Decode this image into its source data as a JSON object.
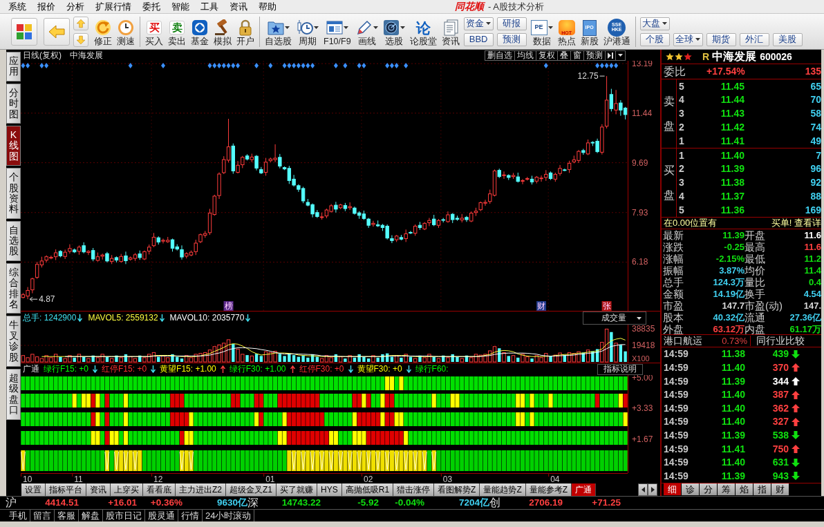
{
  "menu_bar": {
    "items": [
      "系统",
      "报价",
      "分析",
      "扩展行情",
      "委托",
      "智能",
      "工具",
      "资讯",
      "帮助"
    ],
    "brand": "同花顺",
    "title": "- A股技术分析"
  },
  "toolbar": {
    "tools": [
      {
        "label": "修正",
        "dropdown": false
      },
      {
        "label": "测速",
        "dropdown": false
      },
      {
        "label": "买入",
        "dropdown": false,
        "glyph": "买"
      },
      {
        "label": "卖出",
        "dropdown": false,
        "glyph": "卖"
      },
      {
        "label": "基金",
        "dropdown": false
      },
      {
        "label": "模拟",
        "dropdown": false
      },
      {
        "label": "开户",
        "dropdown": false
      },
      {
        "label": "自选股",
        "dropdown": true
      },
      {
        "label": "周期",
        "dropdown": true
      },
      {
        "label": "F10/F9",
        "dropdown": true
      },
      {
        "label": "画线",
        "dropdown": true
      },
      {
        "label": "选股",
        "dropdown": true
      },
      {
        "label": "论股堂",
        "dropdown": false,
        "glyph": "论"
      },
      {
        "label": "资讯",
        "dropdown": false
      }
    ],
    "stacked": [
      {
        "top": {
          "label": "资金",
          "dropdown": true
        },
        "bottom": {
          "label": "BBD",
          "dropdown": false
        }
      },
      {
        "top": {
          "label": "研报",
          "dropdown": false
        },
        "bottom": {
          "label": "预测",
          "dropdown": false
        }
      }
    ],
    "extras": [
      {
        "label": "数据",
        "dropdown": true,
        "glyph": "PE"
      },
      {
        "label": "热点",
        "dropdown": false,
        "glyph": "HOT"
      },
      {
        "label": "新股",
        "dropdown": false,
        "glyph": "IPO"
      },
      {
        "label": "沪港通",
        "dropdown": false,
        "glyph": "SSE HKE"
      }
    ],
    "markets": [
      {
        "top": {
          "label": "大盘",
          "dropdown": true
        },
        "bottom": {
          "label": "个股",
          "dropdown": false
        }
      },
      {
        "bottom": {
          "label": "全球",
          "dropdown": true
        }
      },
      {
        "bottom": {
          "label": "期货",
          "dropdown": false
        }
      },
      {
        "bottom": {
          "label": "外汇",
          "dropdown": false
        }
      },
      {
        "bottom": {
          "label": "美股",
          "dropdown": false
        }
      }
    ]
  },
  "side_tabs": [
    {
      "label": "应用",
      "selected": false
    },
    {
      "label": "分时图",
      "selected": false
    },
    {
      "label": "K线图",
      "selected": true
    },
    {
      "label": "个股资料",
      "selected": false
    },
    {
      "label": "自选股",
      "selected": false
    },
    {
      "label": "综合排名",
      "selected": false
    },
    {
      "label": "牛叉诊股",
      "selected": false
    },
    {
      "label": "超级盘口",
      "selected": false
    }
  ],
  "chart": {
    "period": "日线(复权)",
    "stock": "中海发展",
    "tools": [
      "删自选",
      "均线",
      "复权",
      "叠",
      "窗",
      "预测"
    ],
    "events": [
      {
        "label": "榜",
        "color": "#5a2a8a"
      },
      {
        "label": "财",
        "color": "#203a8a"
      },
      {
        "label": "张",
        "color": "#b01818"
      }
    ],
    "chart_data": {
      "type": "candlestick",
      "ohlc": [
        [
          4.93,
          5.09,
          4.9,
          5.03
        ],
        [
          4.98,
          5.3,
          4.87,
          5.18
        ],
        [
          5.2,
          5.63,
          5.08,
          5.59
        ],
        [
          5.64,
          6.19,
          5.59,
          6.1
        ],
        [
          6.08,
          6.37,
          5.99,
          6.22
        ],
        [
          6.25,
          6.42,
          6.17,
          6.37
        ],
        [
          6.32,
          6.41,
          6.28,
          6.35
        ],
        [
          6.37,
          6.63,
          6.25,
          6.51
        ],
        [
          6.56,
          6.6,
          6.35,
          6.4
        ],
        [
          6.38,
          6.62,
          6.29,
          6.53
        ],
        [
          6.56,
          6.81,
          6.48,
          6.66
        ],
        [
          6.61,
          6.66,
          6.5,
          6.54
        ],
        [
          6.56,
          6.77,
          6.44,
          6.71
        ],
        [
          6.76,
          6.88,
          6.49,
          6.54
        ],
        [
          6.52,
          6.6,
          6.43,
          6.56
        ],
        [
          6.59,
          6.68,
          6.21,
          6.29
        ],
        [
          6.24,
          6.52,
          6.2,
          6.37
        ],
        [
          6.39,
          6.48,
          6.27,
          6.43
        ],
        [
          6.48,
          6.54,
          6.17,
          6.22
        ],
        [
          6.2,
          6.43,
          6.11,
          6.31
        ],
        [
          6.34,
          6.38,
          6.17,
          6.25
        ],
        [
          6.2,
          6.47,
          6.16,
          6.38
        ],
        [
          6.4,
          6.55,
          6.11,
          6.23
        ],
        [
          6.28,
          6.38,
          6.23,
          6.33
        ],
        [
          6.31,
          6.5,
          6.22,
          6.44
        ],
        [
          6.47,
          6.59,
          6.26,
          6.34
        ],
        [
          6.29,
          6.59,
          6.25,
          6.55
        ],
        [
          6.57,
          6.8,
          6.45,
          6.71
        ],
        [
          6.76,
          7.21,
          6.71,
          7.06
        ],
        [
          7.04,
          7.09,
          6.8,
          6.89
        ],
        [
          6.92,
          7.01,
          6.84,
          6.95
        ],
        [
          6.9,
          7.07,
          6.86,
          6.95
        ],
        [
          6.97,
          7.01,
          6.55,
          6.67
        ],
        [
          6.72,
          6.81,
          6.59,
          6.64
        ],
        [
          6.62,
          6.77,
          6.27,
          6.36
        ],
        [
          6.39,
          6.53,
          6.31,
          6.48
        ],
        [
          6.43,
          6.59,
          6.39,
          6.53
        ],
        [
          6.55,
          6.97,
          6.43,
          6.85
        ],
        [
          6.9,
          7.19,
          6.85,
          7.15
        ],
        [
          7.13,
          7.28,
          7.04,
          7.19
        ],
        [
          7.22,
          8.06,
          7.14,
          7.91
        ],
        [
          7.86,
          8.56,
          7.82,
          8.51
        ],
        [
          8.53,
          9.35,
          8.41,
          9.29
        ],
        [
          9.34,
          9.92,
          9.29,
          9.8
        ],
        [
          9.78,
          11.24,
          9.7,
          10.25
        ],
        [
          10.28,
          10.37,
          9.3,
          9.4
        ],
        [
          9.35,
          9.75,
          9.31,
          9.6
        ],
        [
          9.62,
          9.93,
          9.5,
          9.88
        ],
        [
          9.93,
          9.99,
          9.77,
          9.82
        ],
        [
          9.8,
          10.01,
          9.71,
          9.89
        ],
        [
          9.92,
          9.96,
          9.42,
          9.5
        ],
        [
          9.45,
          9.54,
          9.29,
          9.33
        ],
        [
          9.35,
          9.86,
          9.23,
          9.71
        ],
        [
          9.76,
          9.87,
          9.71,
          9.82
        ],
        [
          9.8,
          10.34,
          9.71,
          9.85
        ],
        [
          9.88,
          10.0,
          9.49,
          9.57
        ],
        [
          9.52,
          9.56,
          9.43,
          9.47
        ],
        [
          9.49,
          9.58,
          8.94,
          9.06
        ],
        [
          9.11,
          9.26,
          8.85,
          8.9
        ],
        [
          8.88,
          8.93,
          8.66,
          8.75
        ],
        [
          8.78,
          8.84,
          8.26,
          8.34
        ],
        [
          8.29,
          8.41,
          8.15,
          8.19
        ],
        [
          8.21,
          8.25,
          7.76,
          7.88
        ],
        [
          7.93,
          8.02,
          7.74,
          7.79
        ],
        [
          7.77,
          7.93,
          7.68,
          7.78
        ],
        [
          7.81,
          8.07,
          7.73,
          8.02
        ],
        [
          7.97,
          8.23,
          7.93,
          8.17
        ],
        [
          8.19,
          8.31,
          7.93,
          8.05
        ],
        [
          8.1,
          8.24,
          8.05,
          8.2
        ],
        [
          8.18,
          8.27,
          7.98,
          8.07
        ],
        [
          8.1,
          8.29,
          8.02,
          8.14
        ],
        [
          8.09,
          8.14,
          7.86,
          7.9
        ],
        [
          7.92,
          7.98,
          7.71,
          7.83
        ],
        [
          7.88,
          8.0,
          7.67,
          7.72
        ],
        [
          7.7,
          7.74,
          7.39,
          7.48
        ],
        [
          7.51,
          7.64,
          7.43,
          7.55
        ],
        [
          7.5,
          7.65,
          7.42,
          7.46
        ],
        [
          7.48,
          7.53,
          7.28,
          7.4
        ],
        [
          7.45,
          7.51,
          6.98,
          7.03
        ],
        [
          7.01,
          7.13,
          6.85,
          6.94
        ],
        [
          6.97,
          7.14,
          6.89,
          7.1
        ],
        [
          7.05,
          7.14,
          6.95,
          6.99
        ],
        [
          7.01,
          7.33,
          6.89,
          7.18
        ],
        [
          7.23,
          7.28,
          7.17,
          7.22
        ],
        [
          7.2,
          7.51,
          7.11,
          7.45
        ],
        [
          7.48,
          7.6,
          7.32,
          7.4
        ],
        [
          7.35,
          7.59,
          7.31,
          7.55
        ],
        [
          7.57,
          7.74,
          7.45,
          7.65
        ],
        [
          7.7,
          7.85,
          7.45,
          7.5
        ],
        [
          7.48,
          7.7,
          7.39,
          7.65
        ],
        [
          7.68,
          7.74,
          7.58,
          7.66
        ],
        [
          7.61,
          7.97,
          7.57,
          7.85
        ],
        [
          7.87,
          7.91,
          7.56,
          7.68
        ],
        [
          7.73,
          7.82,
          7.64,
          7.69
        ],
        [
          7.67,
          7.88,
          7.58,
          7.73
        ],
        [
          7.76,
          7.81,
          7.6,
          7.68
        ],
        [
          7.63,
          7.97,
          7.59,
          7.91
        ],
        [
          7.93,
          8.1,
          7.81,
          7.98
        ],
        [
          8.03,
          8.32,
          7.98,
          8.28
        ],
        [
          8.26,
          8.38,
          8.17,
          8.29
        ],
        [
          8.32,
          8.74,
          8.24,
          8.59
        ],
        [
          8.54,
          9.45,
          8.5,
          9.4
        ],
        [
          9.42,
          9.48,
          9.15,
          9.2
        ],
        [
          9.25,
          9.38,
          9.12,
          9.26
        ],
        [
          9.24,
          9.28,
          9.08,
          9.17
        ],
        [
          9.2,
          9.33,
          9.12,
          9.24
        ],
        [
          9.19,
          9.34,
          8.99,
          9.03
        ],
        [
          9.05,
          9.11,
          8.93,
          9.06
        ],
        [
          9.11,
          9.19,
          9.06,
          9.13
        ],
        [
          9.11,
          9.23,
          8.92,
          9.01
        ],
        [
          9.04,
          9.22,
          8.96,
          9.18
        ],
        [
          9.13,
          9.24,
          9.02,
          9.15
        ],
        [
          9.17,
          9.43,
          9.05,
          9.28
        ],
        [
          9.33,
          9.38,
          9.08,
          9.13
        ],
        [
          9.11,
          9.34,
          9.02,
          9.28
        ],
        [
          9.31,
          9.61,
          9.23,
          9.49
        ],
        [
          9.44,
          9.48,
          9.39,
          9.43
        ],
        [
          9.45,
          9.76,
          9.33,
          9.67
        ],
        [
          9.72,
          9.94,
          9.67,
          9.79
        ],
        [
          9.77,
          10.14,
          9.68,
          10.09
        ],
        [
          10.12,
          10.18,
          9.97,
          10.05
        ],
        [
          10.0,
          10.51,
          9.96,
          10.39
        ],
        [
          10.41,
          10.45,
          10.28,
          10.4
        ],
        [
          10.45,
          10.54,
          10.03,
          10.08
        ],
        [
          10.06,
          11.05,
          9.98,
          10.95
        ],
        [
          10.98,
          12.75,
          10.9,
          11.9
        ],
        [
          12.1,
          12.3,
          11.5,
          11.6
        ],
        [
          11.55,
          12.26,
          11.4,
          11.78
        ],
        [
          11.8,
          11.9,
          11.35,
          11.55
        ],
        [
          11.62,
          11.66,
          11.22,
          11.39
        ]
      ],
      "ylim": [
        4.46,
        13.29
      ],
      "yticks": [
        13.19,
        11.44,
        9.69,
        7.93,
        6.18
      ],
      "grid": true,
      "annotations": [
        "12.75",
        "4.87"
      ]
    }
  },
  "volume": {
    "readings": [
      {
        "label": "总手: 1242900",
        "color": "#40e0f0",
        "rising": false
      },
      {
        "label": "MAVOL5: 2559132",
        "color": "#ffff40",
        "rising": false
      },
      {
        "label": "MAVOL10: 2035770",
        "color": "#ffffff",
        "rising": false
      }
    ],
    "selector": "成交量",
    "axis": [
      "38835",
      "19418",
      "X100"
    ]
  },
  "indicator": {
    "name": "广通",
    "readings": [
      {
        "label": "绿行F15: +0",
        "color": "#00ff00",
        "rising": false
      },
      {
        "label": "红停F15: +0",
        "color": "#ff3030",
        "rising": false
      },
      {
        "label": "黄望F15: +1.00",
        "color": "#ffff00",
        "rising": true
      },
      {
        "label": "绿行F30: +1.00",
        "color": "#00ff00",
        "rising": true
      },
      {
        "label": "红停F30: +0",
        "color": "#ff3030",
        "rising": false
      },
      {
        "label": "黄望F30: +0",
        "color": "#ffff00",
        "rising": false
      },
      {
        "label": "绿行F60:",
        "color": "#00ff00"
      }
    ],
    "help": "指标说明",
    "axis": [
      "+5.00",
      "+3.33",
      "+1.67"
    ],
    "dates": [
      "10",
      "11",
      "12",
      "01",
      "02",
      "03",
      "04"
    ]
  },
  "formula_tabs": [
    {
      "label": "设置",
      "selected": false
    },
    {
      "label": "指标平台",
      "selected": false
    },
    {
      "label": "资讯",
      "selected": false
    },
    {
      "label": "上穿买",
      "selected": false
    },
    {
      "label": "看看底",
      "selected": false
    },
    {
      "label": "主力进出Z2",
      "selected": false
    },
    {
      "label": "超级金叉Z1",
      "selected": false
    },
    {
      "label": "买了就赚",
      "selected": false
    },
    {
      "label": "HYS",
      "selected": false
    },
    {
      "label": "高抛低吸R1",
      "selected": false
    },
    {
      "label": "猎击涨停",
      "selected": false
    },
    {
      "label": "看图解势Z",
      "selected": false
    },
    {
      "label": "量能趋势Z",
      "selected": false
    },
    {
      "label": "量能参考Z",
      "selected": false
    },
    {
      "label": "广通",
      "selected": true
    }
  ],
  "quote": {
    "rating": [
      {
        "color": "#f4c430"
      },
      {
        "color": "#f4c430"
      },
      {
        "color": "#e02020"
      }
    ],
    "badge": "R",
    "name": "中海发展",
    "code": "600026",
    "ratio": {
      "label": "委比",
      "value": "+17.54%",
      "difference": "135"
    },
    "asks": {
      "label": "卖盘",
      "levels": [
        {
          "level": "5",
          "price": "11.45",
          "volume": "65"
        },
        {
          "level": "4",
          "price": "11.44",
          "volume": "70"
        },
        {
          "level": "3",
          "price": "11.43",
          "volume": "58"
        },
        {
          "level": "2",
          "price": "11.42",
          "volume": "74"
        },
        {
          "level": "1",
          "price": "11.41",
          "volume": "49"
        }
      ]
    },
    "bids": {
      "label": "买盘",
      "levels": [
        {
          "level": "1",
          "price": "11.40",
          "volume": "7"
        },
        {
          "level": "2",
          "price": "11.39",
          "volume": "96"
        },
        {
          "level": "3",
          "price": "11.38",
          "volume": "92"
        },
        {
          "level": "4",
          "price": "11.37",
          "volume": "88"
        },
        {
          "level": "5",
          "price": "11.36",
          "volume": "169"
        }
      ]
    },
    "notice": {
      "left": "在0.00位置有",
      "right": "买单! 查看详"
    },
    "stats": [
      {
        "label": "最新",
        "value": "11.39",
        "color": "#10e010"
      },
      {
        "label": "开盘",
        "value": "11.6",
        "color": "#ffffff"
      },
      {
        "label": "涨跌",
        "value": "-0.25",
        "color": "#10e010"
      },
      {
        "label": "最高",
        "value": "11.6",
        "color": "#ff4040"
      },
      {
        "label": "涨幅",
        "value": "-2.15%",
        "color": "#10e010"
      },
      {
        "label": "最低",
        "value": "11.2",
        "color": "#10e010"
      },
      {
        "label": "振幅",
        "value": "3.87%",
        "color": "#40d0f0"
      },
      {
        "label": "均价",
        "value": "11.4",
        "color": "#10e010"
      },
      {
        "label": "总手",
        "value": "124.3万",
        "color": "#40d0f0"
      },
      {
        "label": "量比",
        "value": "0.4",
        "color": "#10e010"
      },
      {
        "label": "金额",
        "value": "14.19亿",
        "color": "#40d0f0"
      },
      {
        "label": "换手",
        "value": "4.54",
        "color": "#40d0f0"
      },
      {
        "label": "市盈",
        "value": "147.7",
        "color": "#d8d8d8"
      },
      {
        "label": "市盈(动)",
        "value": "147.",
        "color": "#d8d8d8"
      },
      {
        "label": "股本",
        "value": "40.32亿",
        "color": "#40d0f0"
      },
      {
        "label": "流通",
        "value": "27.36亿",
        "color": "#40d0f0"
      },
      {
        "label": "外盘",
        "value": "63.12万",
        "color": "#ff4040"
      },
      {
        "label": "内盘",
        "value": "61.17万",
        "color": "#10e010"
      }
    ],
    "sector": {
      "name": "港口航运",
      "change": "0.73%",
      "compare": "同行业比较"
    },
    "ticks": [
      {
        "time": "14:59",
        "price": "11.38",
        "volume": "439",
        "rising": false,
        "color": "#10e010"
      },
      {
        "time": "14:59",
        "price": "11.40",
        "volume": "370",
        "rising": true,
        "color": "#ff4040"
      },
      {
        "time": "14:59",
        "price": "11.39",
        "volume": "344",
        "rising": true,
        "color": "#ffffff"
      },
      {
        "time": "14:59",
        "price": "11.40",
        "volume": "387",
        "rising": true,
        "color": "#ff4040"
      },
      {
        "time": "14:59",
        "price": "11.40",
        "volume": "362",
        "rising": true,
        "color": "#ff4040"
      },
      {
        "time": "14:59",
        "price": "11.40",
        "volume": "327",
        "rising": true,
        "color": "#ff4040"
      },
      {
        "time": "14:59",
        "price": "11.39",
        "volume": "538",
        "rising": false,
        "color": "#10e010"
      },
      {
        "time": "14:59",
        "price": "11.41",
        "volume": "750",
        "rising": true,
        "color": "#ff4040"
      },
      {
        "time": "14:59",
        "price": "11.40",
        "volume": "631",
        "rising": false,
        "color": "#10e010"
      },
      {
        "time": "14:59",
        "price": "11.39",
        "volume": "943",
        "rising": false,
        "color": "#10e010"
      }
    ],
    "tabs": [
      {
        "label": "细",
        "selected": true
      },
      {
        "label": "诊",
        "selected": false
      },
      {
        "label": "分",
        "selected": false
      },
      {
        "label": "筹",
        "selected": false
      },
      {
        "label": "焰",
        "selected": false
      },
      {
        "label": "指",
        "selected": false
      },
      {
        "label": "财",
        "selected": false
      }
    ]
  },
  "indices": [
    {
      "market": "沪",
      "value": "4414.51",
      "change": "+16.01",
      "percent": "+0.36%",
      "amount": "9630亿",
      "rising": true
    },
    {
      "market": "深",
      "value": "14743.22",
      "change": "-5.92",
      "percent": "-0.04%",
      "amount": "7204亿",
      "rising": false
    },
    {
      "market": "创",
      "value": "2706.19",
      "change": "+71.25",
      "rising": true
    }
  ],
  "footer_links": [
    "手机",
    "留言",
    "客服",
    "解盘",
    "股市日记",
    "股灵通",
    "行情",
    "24小时滚动"
  ]
}
